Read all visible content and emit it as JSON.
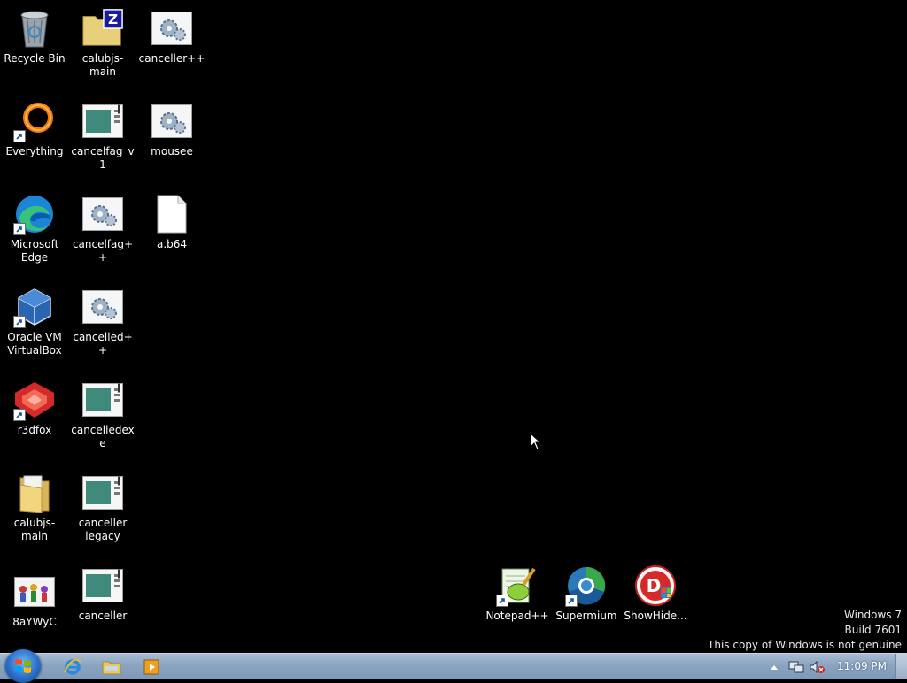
{
  "desktop": {
    "icons": [
      {
        "label": "Recycle Bin",
        "icon": "recycle-bin-icon"
      },
      {
        "label": "calubjs-main",
        "icon": "zip-folder-icon"
      },
      {
        "label": "canceller++",
        "icon": "exe-gear-icon"
      },
      {
        "label": "Everything",
        "icon": "everything-icon"
      },
      {
        "label": "cancelfag_v1",
        "icon": "window-app-icon"
      },
      {
        "label": "mousee",
        "icon": "exe-gear-icon"
      },
      {
        "label": "Microsoft Edge",
        "icon": "edge-icon"
      },
      {
        "label": "cancelfag++",
        "icon": "exe-gear-icon"
      },
      {
        "label": "a.b64",
        "icon": "blank-file-icon"
      },
      {
        "label": "Oracle VM VirtualBox",
        "icon": "virtualbox-icon"
      },
      {
        "label": "cancelled++",
        "icon": "exe-gear-icon"
      },
      {
        "label": "r3dfox",
        "icon": "r3dfox-icon"
      },
      {
        "label": "cancelledexe",
        "icon": "window-app-icon"
      },
      {
        "label": "calubjs-main",
        "icon": "folder-icon"
      },
      {
        "label": "canceller legacy",
        "icon": "window-app-icon"
      },
      {
        "label": "8aYWyC",
        "icon": "image-file-icon"
      },
      {
        "label": "canceller",
        "icon": "window-app-icon"
      },
      {
        "label": "Notepad++",
        "icon": "notepad-plus-plus-icon"
      },
      {
        "label": "Supermium",
        "icon": "supermium-icon"
      },
      {
        "label": "ShowHide...",
        "icon": "showhide-icon"
      }
    ]
  },
  "watermark": {
    "line1": "Windows 7",
    "line2": "Build 7601",
    "line3": "This copy of Windows is not genuine"
  },
  "taskbar": {
    "start": "start-orb-icon",
    "pinned": [
      "internet-explorer-icon",
      "windows-explorer-icon",
      "media-player-icon"
    ],
    "tray": [
      "show-hidden-icons-arrow",
      "network-icon",
      "volume-muted-icon"
    ],
    "clock": "11:09 PM"
  },
  "colors": {
    "desktop_bg": "#000000",
    "taskbar_top": "#a8bdd3",
    "taskbar_bottom": "#7d99b8"
  }
}
